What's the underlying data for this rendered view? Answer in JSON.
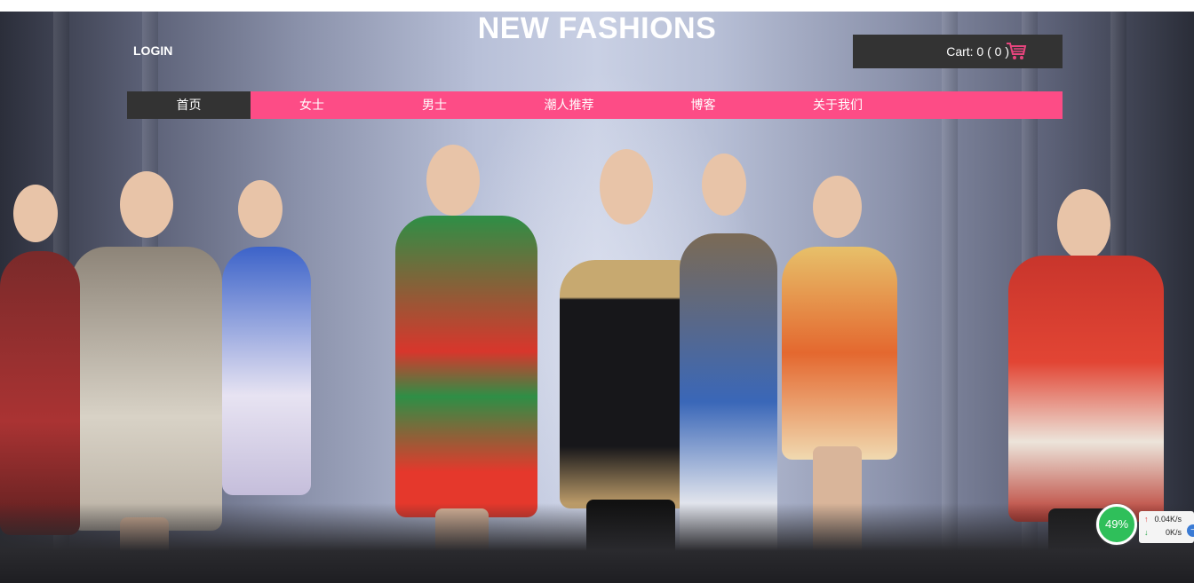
{
  "header": {
    "title": "NEW FASHIONS",
    "login_label": "LOGIN",
    "cart_label": "Cart: 0 ( 0 )",
    "cart_icon": "shopping-cart-icon"
  },
  "nav": {
    "items": [
      {
        "label": "首页",
        "active": true
      },
      {
        "label": "女士",
        "active": false
      },
      {
        "label": "男士",
        "active": false
      },
      {
        "label": "潮人推荐",
        "active": false
      },
      {
        "label": "博客",
        "active": false
      },
      {
        "label": "关于我们",
        "active": false
      }
    ]
  },
  "hero": {
    "image": "fashion-runway-photo"
  },
  "net_widget": {
    "percent": "49%",
    "upload": "0.04K/s",
    "download": "0K/s"
  },
  "colors": {
    "nav_bg": "#fd4c86",
    "dark": "#333333",
    "accent_pink": "#e8457e",
    "gauge_green": "#2fbf5a"
  }
}
